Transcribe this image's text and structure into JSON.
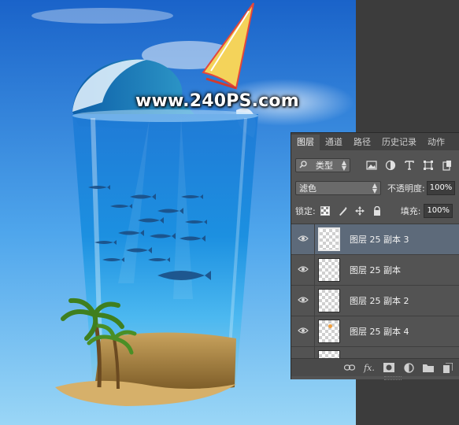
{
  "canvas": {
    "watermark": "www.240PS.com"
  },
  "panel": {
    "tabs": [
      {
        "label": "图层",
        "active": true
      },
      {
        "label": "通道",
        "active": false
      },
      {
        "label": "路径",
        "active": false
      },
      {
        "label": "历史记录",
        "active": false
      },
      {
        "label": "动作",
        "active": false
      }
    ],
    "filter": {
      "search_icon": "search-icon",
      "kind_label": "类型",
      "filter_icons": [
        "image-filter-icon",
        "adjustment-filter-icon",
        "text-filter-icon",
        "shape-filter-icon",
        "smart-object-filter-icon"
      ]
    },
    "blend_mode": "滤色",
    "opacity_label": "不透明度:",
    "opacity_value": "100%",
    "lock_label": "锁定:",
    "fill_label": "填充:",
    "fill_value": "100%",
    "layers": [
      {
        "name": "图层 25 副本 3",
        "selected": true,
        "visible": true
      },
      {
        "name": "图层 25 副本",
        "selected": false,
        "visible": true
      },
      {
        "name": "图层 25 副本 2",
        "selected": false,
        "visible": true
      },
      {
        "name": "图层 25 副本 4",
        "selected": false,
        "visible": true
      }
    ],
    "footer_icons": [
      "link-icon",
      "fx-icon",
      "mask-icon",
      "adjustment-icon",
      "folder-icon",
      "new-layer-icon"
    ],
    "footer_fx_label": "fx."
  },
  "colors": {
    "panel_bg": "#535353",
    "selected_row": "#5d6a7a",
    "sky_top": "#1a63c9",
    "sky_bottom": "#8fd0f5"
  }
}
